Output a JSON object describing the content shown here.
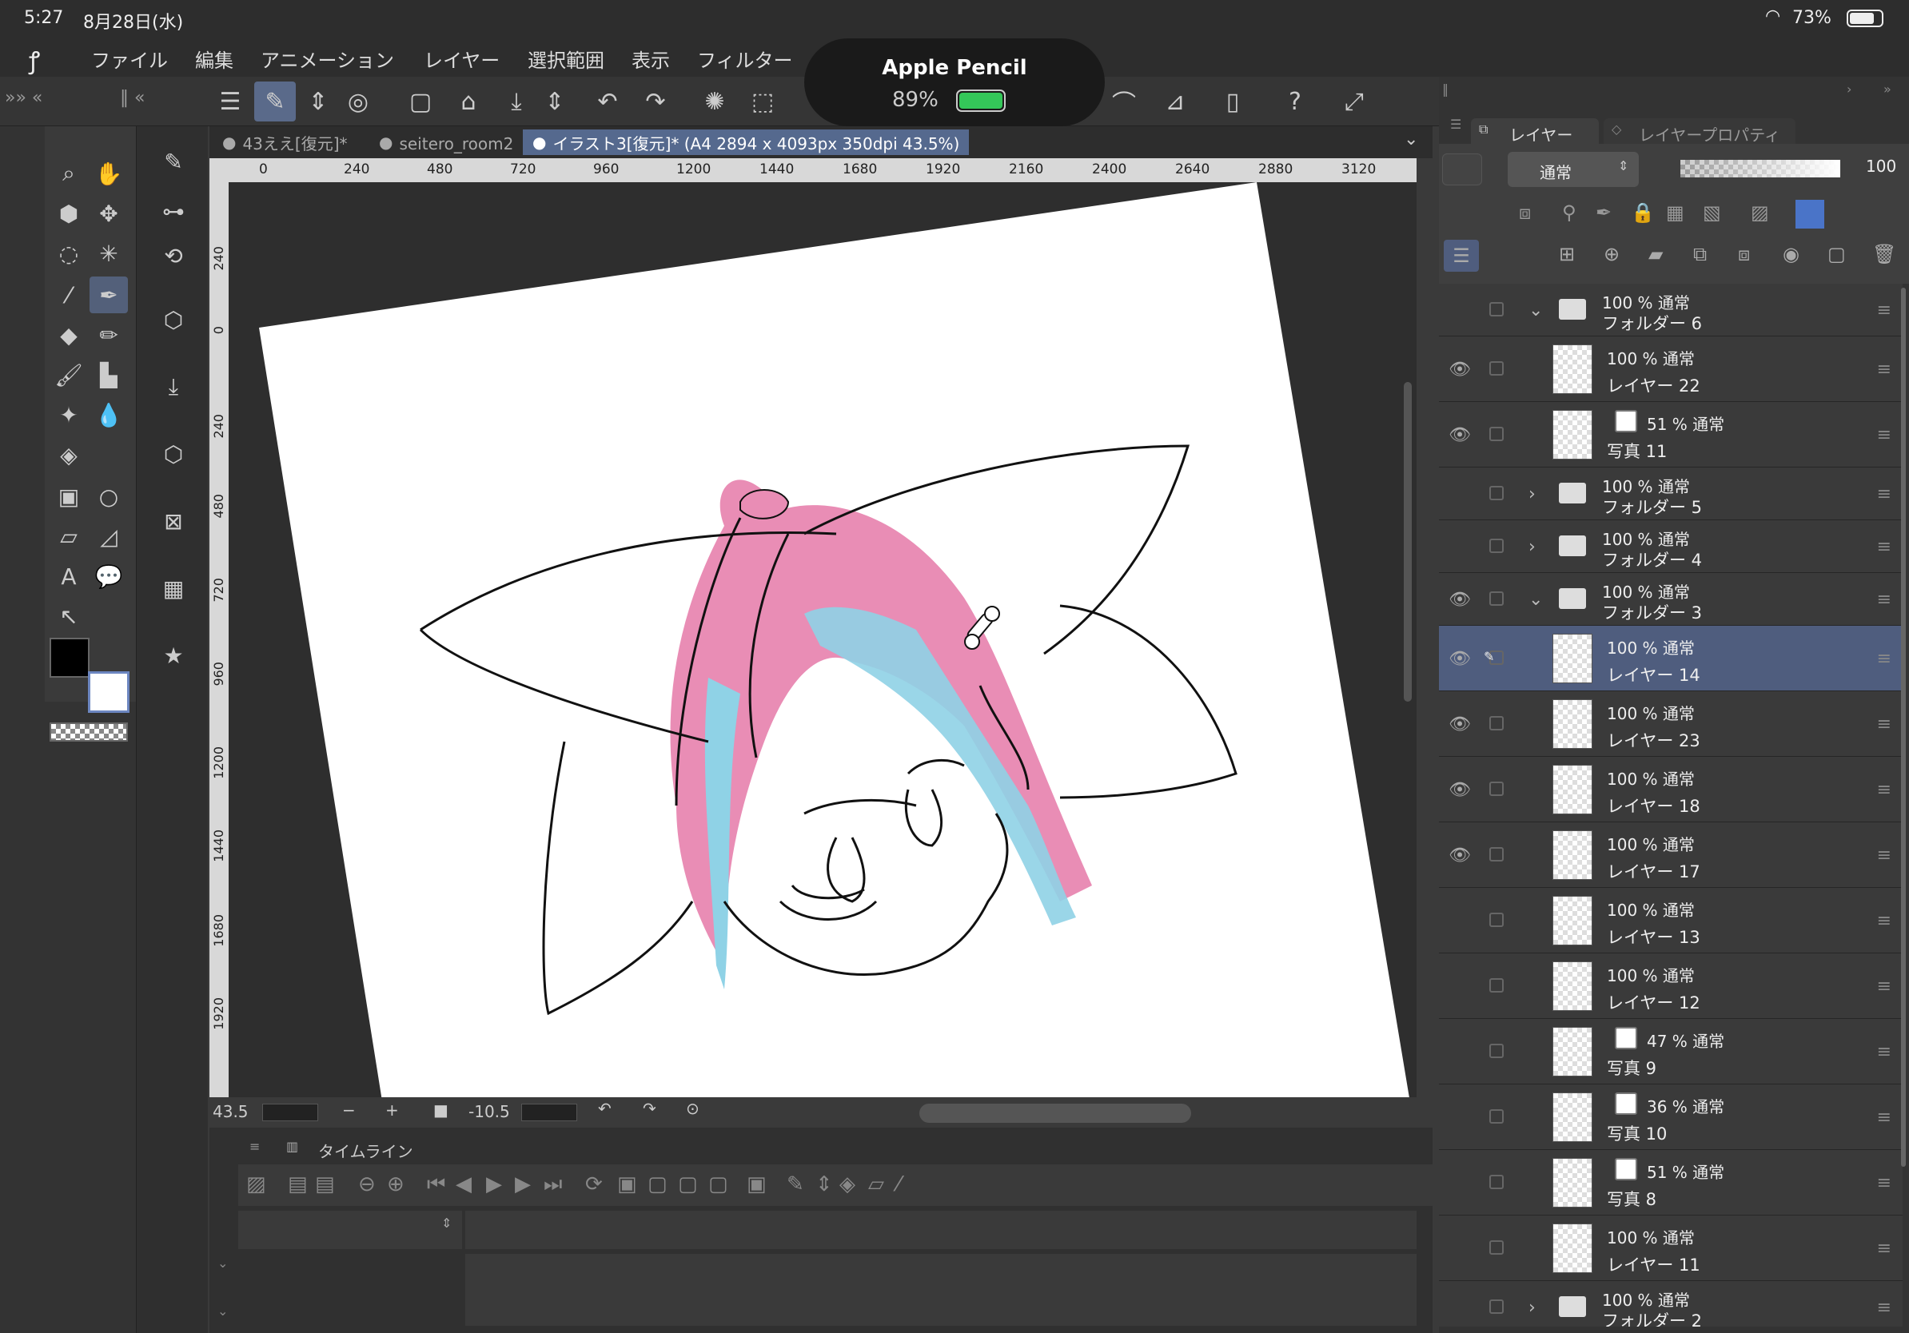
{
  "status": {
    "time": "5:27",
    "date": "8月28日(水)",
    "battery": "73%",
    "pencil_title": "Apple Pencil",
    "pencil_pct": "89%"
  },
  "menu": [
    "ファイル",
    "編集",
    "アニメーション",
    "レイヤー",
    "選択範囲",
    "表示",
    "フィルター"
  ],
  "tabs": [
    "43ええ[復元]*",
    "seitero_room2（",
    "イラスト3[復元]* (A4 2894 x 4093px 350dpi 43.5%)"
  ],
  "ruler_top": [
    "0",
    "240",
    "480",
    "720",
    "960",
    "1200",
    "1440",
    "1680",
    "1920",
    "2160",
    "2400",
    "2640",
    "2880",
    "3120"
  ],
  "ruler_left": [
    "240",
    "0",
    "240",
    "480",
    "720",
    "960",
    "1200",
    "1440",
    "1680",
    "1920"
  ],
  "nav": {
    "zoom": "43.5",
    "minus": "−",
    "plus": "+",
    "angle": "-10.5"
  },
  "timeline": {
    "title": "タイムライン"
  },
  "panel": {
    "tab_layer": "レイヤー",
    "tab_prop": "レイヤープロパティ",
    "blend": "通常",
    "opacity": "100"
  },
  "layers": [
    {
      "pct": "100 % 通常",
      "name": "フォルダー 6",
      "type": "folder",
      "open": true
    },
    {
      "pct": "100 % 通常",
      "name": "レイヤー 22",
      "type": "layer",
      "eye": true
    },
    {
      "pct": "51 % 通常",
      "name": "写真 11",
      "type": "photo",
      "eye": true
    },
    {
      "pct": "100 % 通常",
      "name": "フォルダー 5",
      "type": "folder",
      "open": false
    },
    {
      "pct": "100 % 通常",
      "name": "フォルダー 4",
      "type": "folder",
      "open": false
    },
    {
      "pct": "100 % 通常",
      "name": "フォルダー 3",
      "type": "folder",
      "open": true,
      "eye": true
    },
    {
      "pct": "100 % 通常",
      "name": "レイヤー 14",
      "type": "layer",
      "eye": true,
      "sel": true
    },
    {
      "pct": "100 % 通常",
      "name": "レイヤー 23",
      "type": "layer",
      "eye": true
    },
    {
      "pct": "100 % 通常",
      "name": "レイヤー 18",
      "type": "layer",
      "eye": true
    },
    {
      "pct": "100 % 通常",
      "name": "レイヤー 17",
      "type": "layer",
      "eye": true
    },
    {
      "pct": "100 % 通常",
      "name": "レイヤー 13",
      "type": "layer"
    },
    {
      "pct": "100 % 通常",
      "name": "レイヤー 12",
      "type": "layer"
    },
    {
      "pct": "47 % 通常",
      "name": "写真 9",
      "type": "photo"
    },
    {
      "pct": "36 % 通常",
      "name": "写真 10",
      "type": "photo"
    },
    {
      "pct": "51 % 通常",
      "name": "写真 8",
      "type": "photo"
    },
    {
      "pct": "100 % 通常",
      "name": "レイヤー 11",
      "type": "layer"
    },
    {
      "pct": "100 % 通常",
      "name": "フォルダー 2",
      "type": "folder",
      "open": false
    }
  ]
}
